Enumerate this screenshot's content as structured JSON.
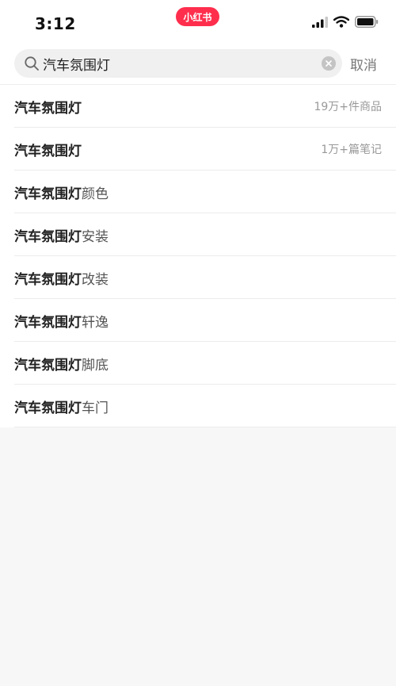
{
  "status_bar": {
    "time": "3:12",
    "app_badge": "小红书",
    "icons": [
      "signal-icon",
      "wifi-icon",
      "battery-icon"
    ]
  },
  "search": {
    "value": "汽车氛围灯",
    "cancel_label": "取消",
    "icons": [
      "search-icon",
      "clear-icon"
    ]
  },
  "suggestions": [
    {
      "keyword": "汽车氛围灯",
      "suffix": "",
      "meta": "19万+件商品"
    },
    {
      "keyword": "汽车氛围灯",
      "suffix": "",
      "meta": "1万+篇笔记"
    },
    {
      "keyword": "汽车氛围灯",
      "suffix": "颜色",
      "meta": ""
    },
    {
      "keyword": "汽车氛围灯",
      "suffix": "安装",
      "meta": ""
    },
    {
      "keyword": "汽车氛围灯",
      "suffix": "改装",
      "meta": ""
    },
    {
      "keyword": "汽车氛围灯",
      "suffix": "轩逸",
      "meta": ""
    },
    {
      "keyword": "汽车氛围灯",
      "suffix": "脚底",
      "meta": ""
    },
    {
      "keyword": "汽车氛围灯",
      "suffix": "车门",
      "meta": ""
    }
  ],
  "colors": {
    "brand": "#ff2e4d",
    "keyword_text": "#222222",
    "meta_text": "#999999",
    "background": "#f7f7f7"
  }
}
